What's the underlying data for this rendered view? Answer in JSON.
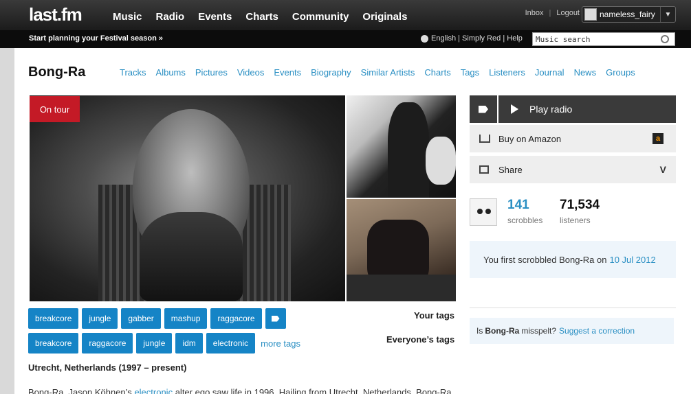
{
  "header": {
    "logo": "last.fm",
    "nav": [
      "Music",
      "Radio",
      "Events",
      "Charts",
      "Community",
      "Originals"
    ],
    "inbox": "Inbox",
    "logout": "Logout",
    "username": "nameless_fairy"
  },
  "subbar": {
    "festival": "Start planning your Festival season »",
    "language": "English | Simply Red | Help",
    "search_value": "Music search"
  },
  "artist": {
    "name": "Bong-Ra",
    "tabs": [
      "Tracks",
      "Albums",
      "Pictures",
      "Videos",
      "Events",
      "Biography",
      "Similar Artists",
      "Charts",
      "Tags",
      "Listeners",
      "Journal",
      "News",
      "Groups"
    ],
    "on_tour": "On tour",
    "your_tags": [
      "breakcore",
      "jungle",
      "gabber",
      "mashup",
      "raggacore"
    ],
    "your_tags_label": "Your tags",
    "everyone_tags": [
      "breakcore",
      "raggacore",
      "jungle",
      "idm",
      "electronic"
    ],
    "more_tags": "more tags",
    "everyone_tags_label": "Everyone’s tags",
    "origin": "Utrecht, Netherlands (1997 – present)",
    "bio_start": "Bong-Ra, Jason Köhnen’s",
    "bio_link": "electronic",
    "bio_rest": "alter ego saw life in 1996. Hailing from Utrecht, Netherlands, Bong-Ra"
  },
  "sidebar": {
    "play_radio": "Play radio",
    "buy_amazon": "Buy on Amazon",
    "amazon_glyph": "a",
    "share": "Share",
    "share_caret": "V",
    "scrobbles_value": "141",
    "scrobbles_label": "scrobbles",
    "listeners_value": "71,534",
    "listeners_label": "listeners",
    "first_scrobbled": "You first scrobbled Bong-Ra on",
    "first_date": "10 Jul 2012",
    "misspelt_prefix": "Is",
    "misspelt_name": "Bong-Ra",
    "misspelt_suffix": "misspelt?",
    "suggest": "Suggest a correction"
  },
  "colors": {
    "accent": "#2a8fc3",
    "tag_bg": "#1584c6",
    "on_tour_red": "#c41a26"
  }
}
